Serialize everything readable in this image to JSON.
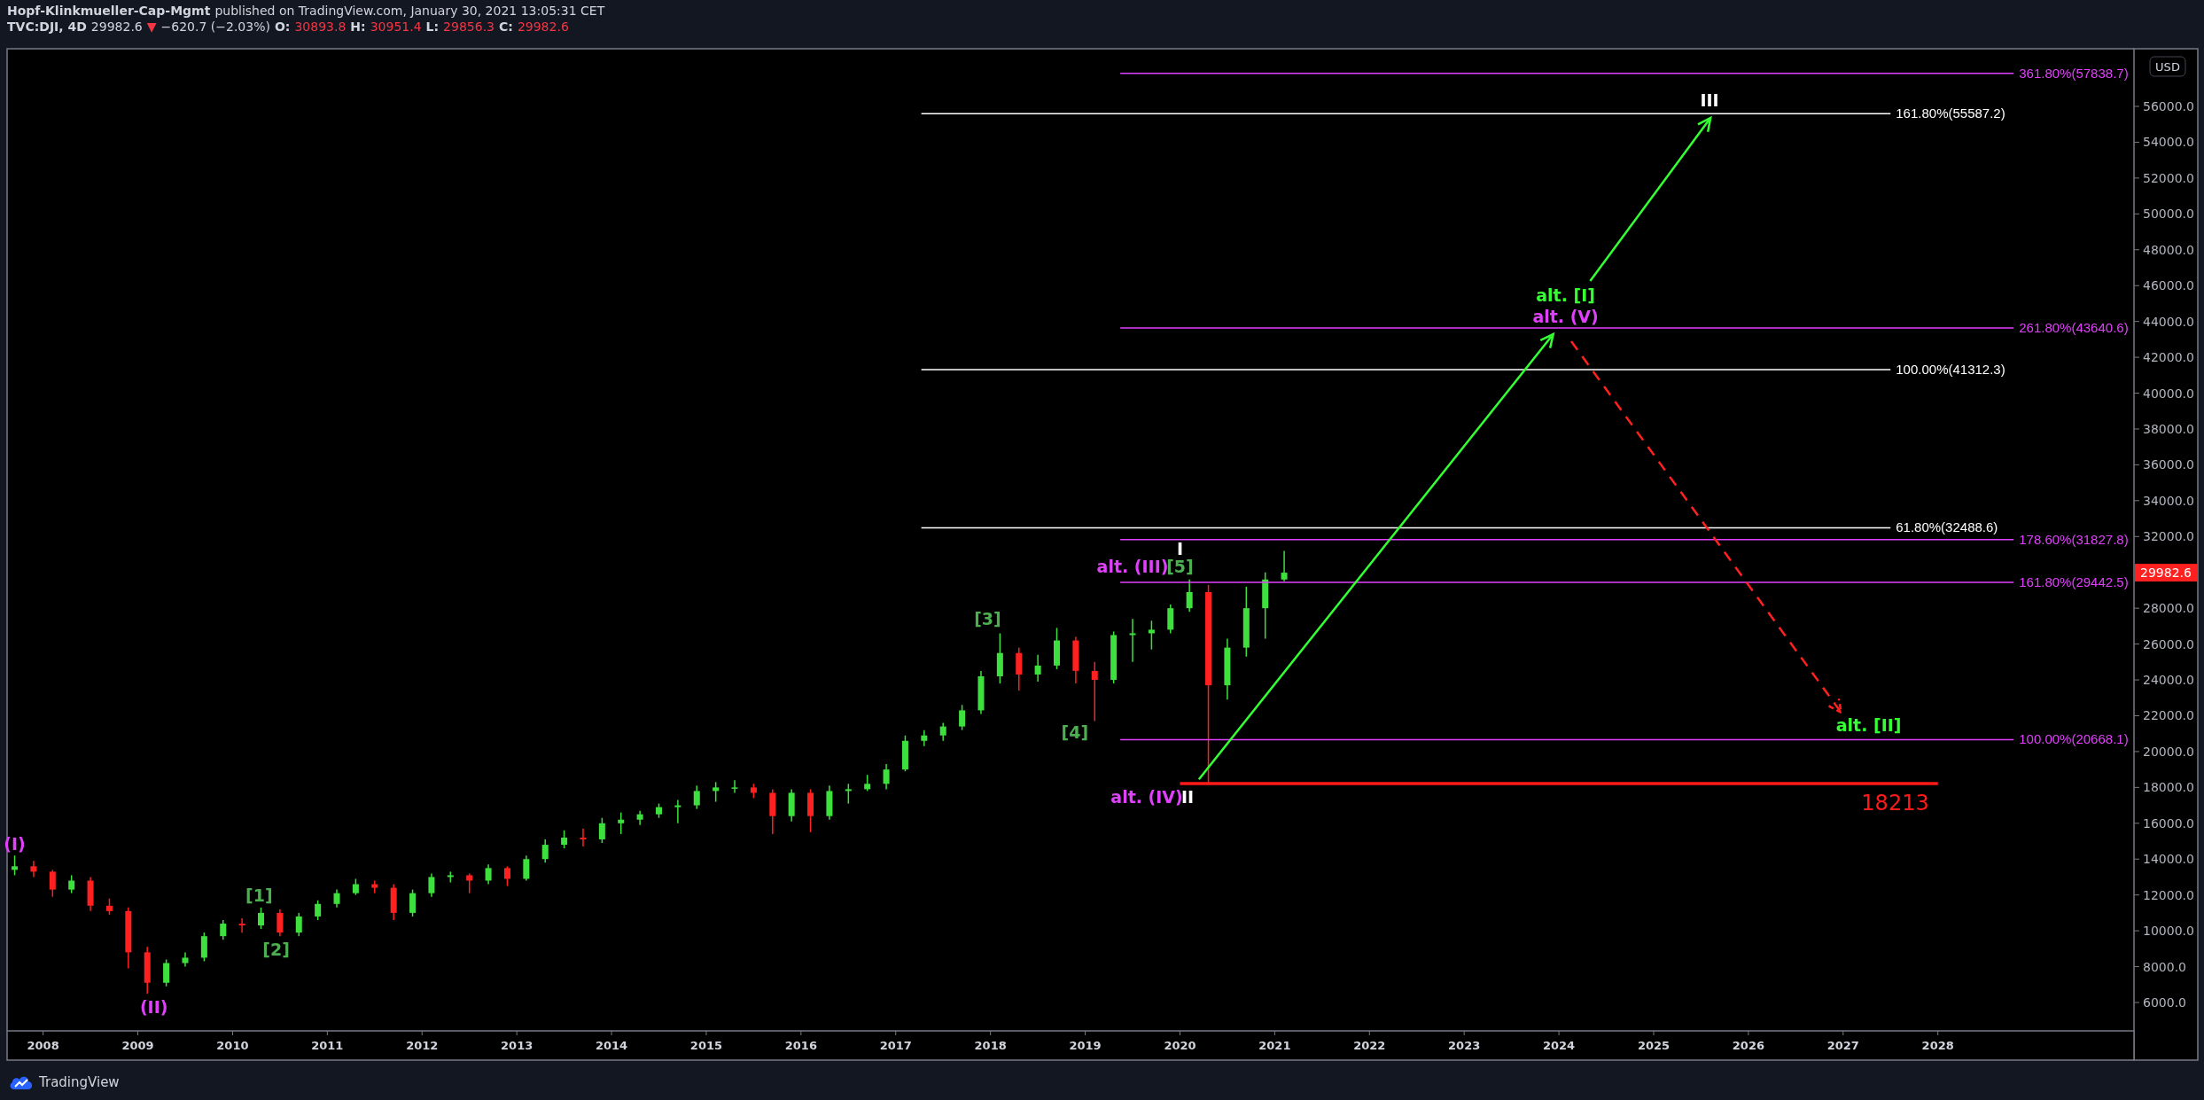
{
  "header": {
    "publisher": "Hopf-Klinkmueller-Cap-Mgmt",
    "published": "published on TradingView.com, January 30, 2021 13:05:31 CET",
    "symbol": "TVC:DJI, 4D",
    "last": "29982.6",
    "change_arrow": "▼",
    "change": "−620.7 (−2.03%)",
    "ohlc": [
      {
        "key": "O:",
        "value": "30893.8"
      },
      {
        "key": "H:",
        "value": "30951.4"
      },
      {
        "key": "L:",
        "value": "29856.3"
      },
      {
        "key": "C:",
        "value": "29982.6"
      }
    ]
  },
  "chart": {
    "currency": "USD",
    "last_price_tag": "29982.6",
    "chart_data": {
      "type": "candlestick",
      "x": [
        2007.7,
        2007.9,
        2008.1,
        2008.3,
        2008.5,
        2008.7,
        2008.9,
        2009.1,
        2009.3,
        2009.5,
        2009.7,
        2009.9,
        2010.1,
        2010.3,
        2010.5,
        2010.7,
        2010.9,
        2011.1,
        2011.3,
        2011.5,
        2011.7,
        2011.9,
        2012.1,
        2012.3,
        2012.5,
        2012.7,
        2012.9,
        2013.1,
        2013.3,
        2013.5,
        2013.7,
        2013.9,
        2014.1,
        2014.3,
        2014.5,
        2014.7,
        2014.9,
        2015.1,
        2015.3,
        2015.5,
        2015.7,
        2015.9,
        2016.1,
        2016.3,
        2016.5,
        2016.7,
        2016.9,
        2017.1,
        2017.3,
        2017.5,
        2017.7,
        2017.9,
        2018.1,
        2018.3,
        2018.5,
        2018.7,
        2018.9,
        2019.1,
        2019.3,
        2019.5,
        2019.7,
        2019.9,
        2020.1,
        2020.3,
        2020.5,
        2020.7,
        2020.9,
        2021.1
      ],
      "ohlc": [
        [
          13400,
          14200,
          13100,
          13600
        ],
        [
          13600,
          13900,
          13000,
          13300
        ],
        [
          13300,
          13400,
          11900,
          12300
        ],
        [
          12300,
          13100,
          12100,
          12800
        ],
        [
          12800,
          13000,
          11100,
          11400
        ],
        [
          11400,
          11800,
          10900,
          11100
        ],
        [
          11100,
          11300,
          7900,
          8800
        ],
        [
          8800,
          9100,
          6500,
          7100
        ],
        [
          7100,
          8400,
          6900,
          8200
        ],
        [
          8200,
          8800,
          8000,
          8500
        ],
        [
          8500,
          9900,
          8300,
          9700
        ],
        [
          9700,
          10600,
          9500,
          10400
        ],
        [
          10400,
          10700,
          9900,
          10300
        ],
        [
          10300,
          11300,
          10100,
          11000
        ],
        [
          11000,
          11200,
          9700,
          9900
        ],
        [
          9900,
          11000,
          9700,
          10800
        ],
        [
          10800,
          11700,
          10600,
          11500
        ],
        [
          11500,
          12300,
          11300,
          12100
        ],
        [
          12100,
          12900,
          12000,
          12600
        ],
        [
          12600,
          12800,
          12100,
          12400
        ],
        [
          12400,
          12600,
          10600,
          11000
        ],
        [
          11000,
          12300,
          10800,
          12100
        ],
        [
          12100,
          13200,
          11900,
          13000
        ],
        [
          13000,
          13300,
          12700,
          13100
        ],
        [
          13100,
          13200,
          12100,
          12800
        ],
        [
          12800,
          13700,
          12600,
          13500
        ],
        [
          13500,
          13600,
          12500,
          12900
        ],
        [
          12900,
          14200,
          12800,
          14000
        ],
        [
          14000,
          15100,
          13800,
          14800
        ],
        [
          14800,
          15600,
          14600,
          15200
        ],
        [
          15200,
          15700,
          14700,
          15100
        ],
        [
          15100,
          16300,
          14900,
          16000
        ],
        [
          16000,
          16600,
          15400,
          16200
        ],
        [
          16200,
          16700,
          15900,
          16500
        ],
        [
          16500,
          17100,
          16300,
          16900
        ],
        [
          16900,
          17300,
          16000,
          17000
        ],
        [
          17000,
          18100,
          16800,
          17800
        ],
        [
          17800,
          18300,
          17200,
          18000
        ],
        [
          18000,
          18400,
          17700,
          18000
        ],
        [
          18000,
          18200,
          17400,
          17700
        ],
        [
          17700,
          17900,
          15400,
          16400
        ],
        [
          16400,
          17900,
          16100,
          17700
        ],
        [
          17700,
          17900,
          15500,
          16400
        ],
        [
          16400,
          18100,
          16200,
          17800
        ],
        [
          17800,
          18200,
          17100,
          17900
        ],
        [
          17900,
          18700,
          17800,
          18200
        ],
        [
          18200,
          19300,
          17900,
          19000
        ],
        [
          19000,
          20900,
          18900,
          20600
        ],
        [
          20600,
          21200,
          20300,
          20900
        ],
        [
          20900,
          21600,
          20600,
          21400
        ],
        [
          21400,
          22600,
          21200,
          22300
        ],
        [
          22300,
          24500,
          22100,
          24200
        ],
        [
          24200,
          26600,
          23800,
          25500
        ],
        [
          25500,
          25800,
          23400,
          24300
        ],
        [
          24300,
          25400,
          23900,
          24800
        ],
        [
          24800,
          26900,
          24600,
          26200
        ],
        [
          26200,
          26400,
          23800,
          24500
        ],
        [
          24500,
          25000,
          21700,
          24000
        ],
        [
          24000,
          26700,
          23800,
          26500
        ],
        [
          26500,
          27400,
          25000,
          26600
        ],
        [
          26600,
          27300,
          25700,
          26800
        ],
        [
          26800,
          28200,
          26600,
          28000
        ],
        [
          28000,
          29600,
          27800,
          28900
        ],
        [
          28900,
          29300,
          18213,
          23700
        ],
        [
          23700,
          26300,
          22900,
          25800
        ],
        [
          25800,
          29200,
          25300,
          28000
        ],
        [
          28000,
          30000,
          26300,
          29600
        ],
        [
          29600,
          31200,
          29500,
          29982.6
        ]
      ],
      "xlim": [
        2007.62,
        2030.07
      ],
      "ylim": [
        4417,
        59215
      ],
      "xticks": [
        2008,
        2009,
        2010,
        2011,
        2012,
        2013,
        2014,
        2015,
        2016,
        2017,
        2018,
        2019,
        2020,
        2021,
        2022,
        2023,
        2024,
        2025,
        2026,
        2027,
        2028
      ],
      "yticks": [
        {
          "value": 6000,
          "label": "6000.0"
        },
        {
          "value": 8000,
          "label": "8000.0"
        },
        {
          "value": 10000,
          "label": "10000.0"
        },
        {
          "value": 12000,
          "label": "12000.0"
        },
        {
          "value": 14000,
          "label": "14000.0"
        },
        {
          "value": 16000,
          "label": "16000.0"
        },
        {
          "value": 18000,
          "label": "18000.0"
        },
        {
          "value": 20000,
          "label": "20000.0"
        },
        {
          "value": 22000,
          "label": "22000.0"
        },
        {
          "value": 24000,
          "label": "24000.0"
        },
        {
          "value": 26000,
          "label": "26000.0"
        },
        {
          "value": 28000,
          "label": "28000.0"
        },
        {
          "value": 32000,
          "label": "32000.0"
        },
        {
          "value": 34000,
          "label": "34000.0"
        },
        {
          "value": 36000,
          "label": "36000.0"
        },
        {
          "value": 38000,
          "label": "38000.0"
        },
        {
          "value": 40000,
          "label": "40000.0"
        },
        {
          "value": 42000,
          "label": "42000.0"
        },
        {
          "value": 44000,
          "label": "44000.0"
        },
        {
          "value": 46000,
          "label": "46000.0"
        },
        {
          "value": 48000,
          "label": "48000.0"
        },
        {
          "value": 50000,
          "label": "50000.0"
        },
        {
          "value": 52000,
          "label": "52000.0"
        },
        {
          "value": 54000,
          "label": "54000.0"
        },
        {
          "value": 56000,
          "label": "56000.0"
        }
      ],
      "ref_lines": [
        {
          "axis": "y",
          "value": 57838.7,
          "label": "361.80%(57838.7)",
          "color": "#e040fb"
        },
        {
          "axis": "y",
          "value": 55587.2,
          "label": "161.80%(55587.2)",
          "color": "#ffffff"
        },
        {
          "axis": "y",
          "value": 43640.6,
          "label": "261.80%(43640.6)",
          "color": "#e040fb"
        },
        {
          "axis": "y",
          "value": 41312.3,
          "label": "100.00%(41312.3)",
          "color": "#ffffff"
        },
        {
          "axis": "y",
          "value": 32488.6,
          "label": "61.80%(32488.6)",
          "color": "#ffffff"
        },
        {
          "axis": "y",
          "value": 31827.8,
          "label": "178.60%(31827.8)",
          "color": "#e040fb"
        },
        {
          "axis": "y",
          "value": 29442.5,
          "label": "161.80%(29442.5)",
          "color": "#e040fb"
        },
        {
          "axis": "y",
          "value": 20668.1,
          "label": "100.00%(20668.1)",
          "color": "#e040fb"
        },
        {
          "axis": "y",
          "value": 18213,
          "label": "18213",
          "color": "#ff1a1a"
        }
      ],
      "annotations": [
        "(I)",
        "(II)",
        "[1]",
        "[2]",
        "[3]",
        "[4]",
        "I",
        "alt. (III)",
        "[5]",
        "alt. (IV)",
        "II",
        "alt. [I]",
        "alt. (V)",
        "III",
        "alt. [II]"
      ]
    }
  },
  "footer": {
    "brand": "TradingView"
  }
}
